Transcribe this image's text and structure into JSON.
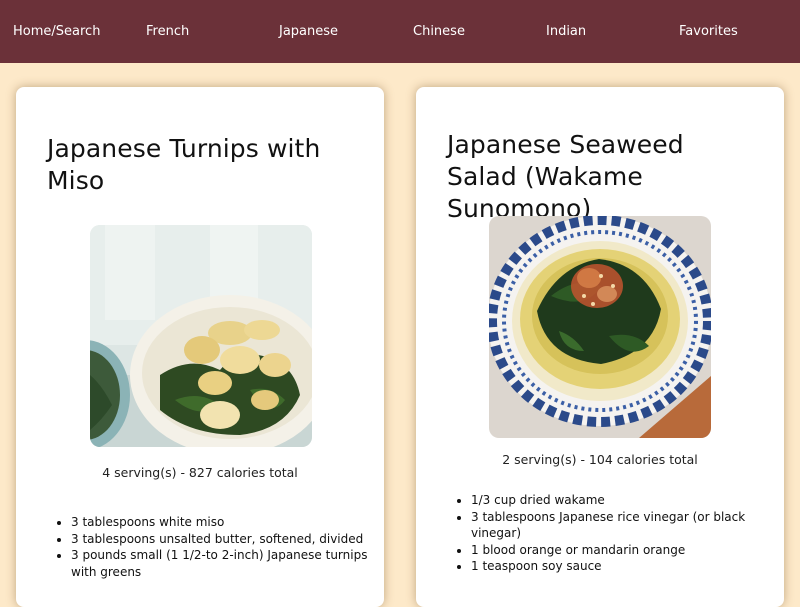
{
  "nav": {
    "items": [
      {
        "label": "Home/Search"
      },
      {
        "label": "French"
      },
      {
        "label": "Japanese"
      },
      {
        "label": "Chinese"
      },
      {
        "label": "Indian"
      },
      {
        "label": "Favorites"
      }
    ]
  },
  "colors": {
    "nav_bg": "#6b3139",
    "page_bg": "#fde9c9",
    "card_bg": "#ffffff"
  },
  "recipes": [
    {
      "title": "Japanese Turnips with Miso",
      "servings_text": "4 serving(s) - 827 calories total",
      "ingredients": [
        "3 tablespoons white miso",
        "3 tablespoons unsalted butter, softened, divided",
        "3 pounds small (1 1/2-to 2-inch) Japanese turnips with greens"
      ]
    },
    {
      "title": "Japanese Seaweed Salad (Wakame Sunomono)",
      "servings_text": "2 serving(s) - 104 calories total",
      "ingredients": [
        "1/3 cup dried wakame",
        "3 tablespoons Japanese rice vinegar (or black vinegar)",
        "1 blood orange or mandarin orange",
        "1 teaspoon soy sauce"
      ]
    }
  ]
}
